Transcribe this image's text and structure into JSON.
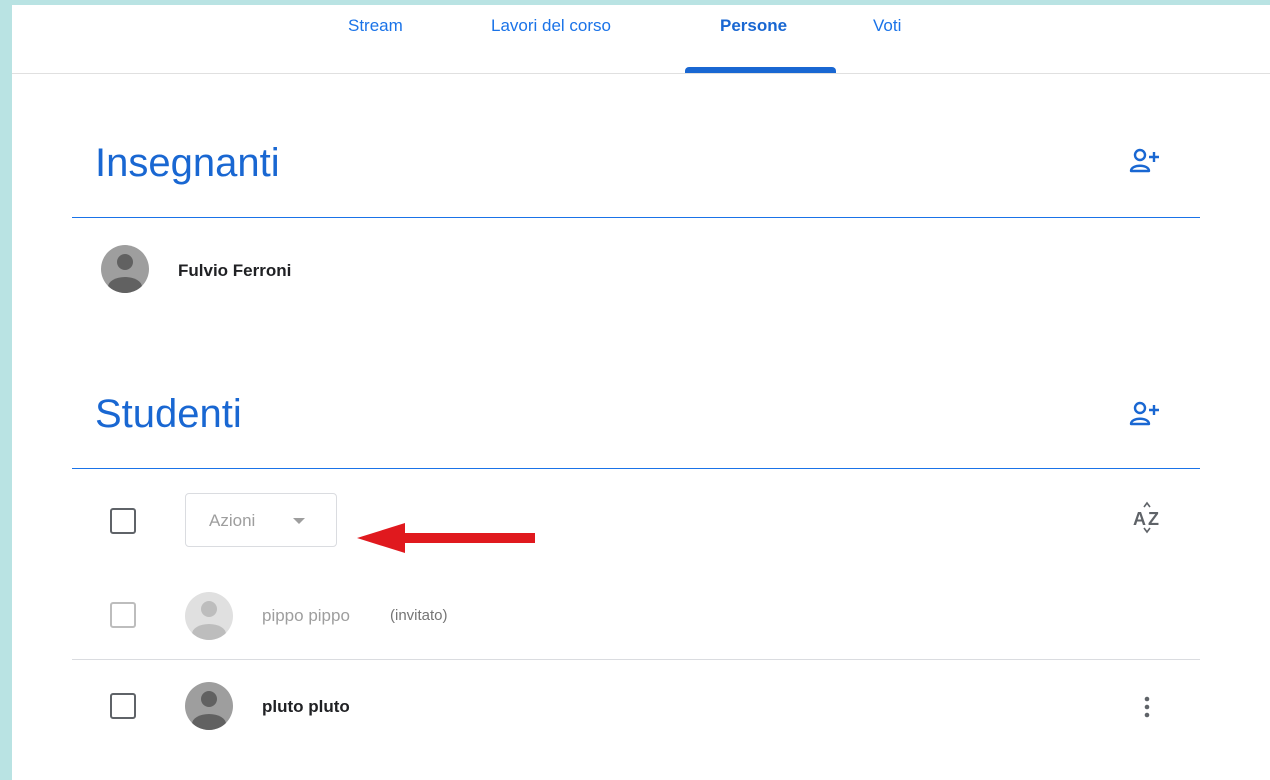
{
  "tabs": [
    {
      "label": "Stream"
    },
    {
      "label": "Lavori del corso"
    },
    {
      "label": "Persone"
    },
    {
      "label": "Voti"
    }
  ],
  "active_tab": "Persone",
  "teachers": {
    "title": "Insegnanti",
    "add_icon": "person-add-icon",
    "people": [
      {
        "name": "Fulvio Ferroni"
      }
    ]
  },
  "students": {
    "title": "Studenti",
    "add_icon": "person-add-icon",
    "actions_label": "Azioni",
    "sort_icon": "sort-az-icon",
    "people": [
      {
        "name": "pippo pippo",
        "status": "(invitato)"
      },
      {
        "name": "pluto pluto"
      }
    ]
  },
  "colors": {
    "accent": "#1967d2",
    "background": "#b9e3e3",
    "annotation_arrow": "#e0191e"
  }
}
